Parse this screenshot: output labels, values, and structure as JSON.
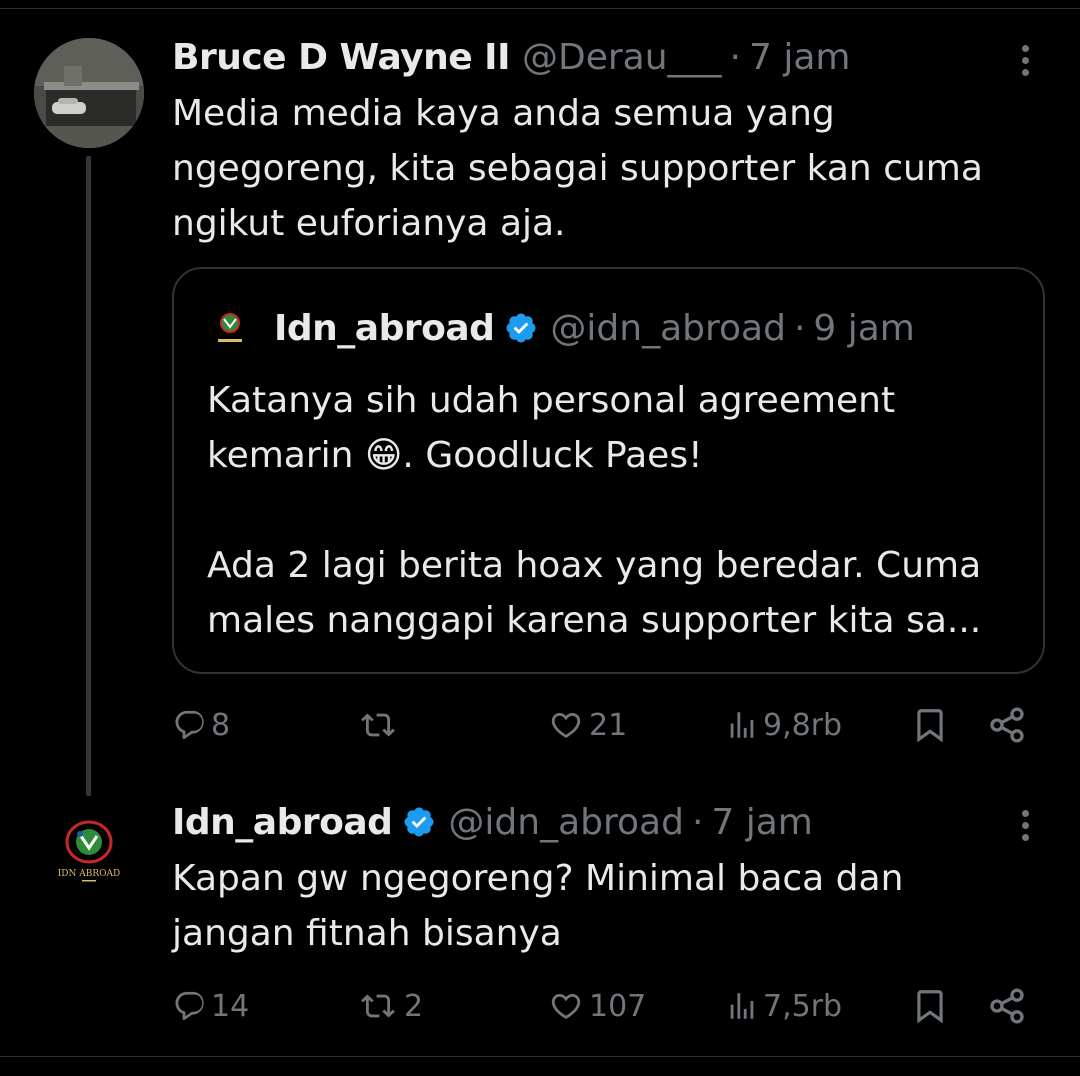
{
  "thread": {
    "tweets": [
      {
        "author": {
          "name": "Bruce D Wayne II",
          "handle": "@Derau___",
          "verified": false,
          "avatar": "garage-photo-avatar"
        },
        "time": "7 jam",
        "text_lines": [
          "Media media kaya anda semua yang",
          "ngegoreng, kita sebagai supporter kan cuma",
          "ngikut euforianya aja."
        ],
        "quote": {
          "author": {
            "name": "Idn_abroad",
            "handle": "@idn_abroad",
            "verified": true,
            "avatar": "idn-abroad-logo"
          },
          "time": "9 jam",
          "text_lines": [
            "Katanya sih udah personal agreement",
            "kemarin 😁. Goodluck Paes!",
            "",
            "Ada 2 lagi berita hoax yang beredar. Cuma",
            "males nanggapi karena supporter kita sa..."
          ]
        },
        "stats": {
          "replies": "8",
          "reposts": "",
          "likes": "21",
          "views": "9,8rb"
        }
      },
      {
        "author": {
          "name": "Idn_abroad",
          "handle": "@idn_abroad",
          "verified": true,
          "avatar": "idn-abroad-logo"
        },
        "time": "7 jam",
        "text_lines": [
          "Kapan gw ngegoreng? Minimal baca dan",
          "jangan fitnah bisanya"
        ],
        "stats": {
          "replies": "14",
          "reposts": "2",
          "likes": "107",
          "views": "7,5rb"
        }
      }
    ]
  },
  "logo_text": "IDN ABROAD",
  "colors": {
    "background": "#000000",
    "text": "#e7e9ea",
    "muted": "#71767b",
    "border": "#2f3336",
    "verified": "#1d9bf0"
  },
  "icons": [
    "reply-icon",
    "repost-icon",
    "like-icon",
    "views-icon",
    "bookmark-icon",
    "share-icon",
    "more-icon",
    "verified-icon"
  ],
  "separator": "·"
}
